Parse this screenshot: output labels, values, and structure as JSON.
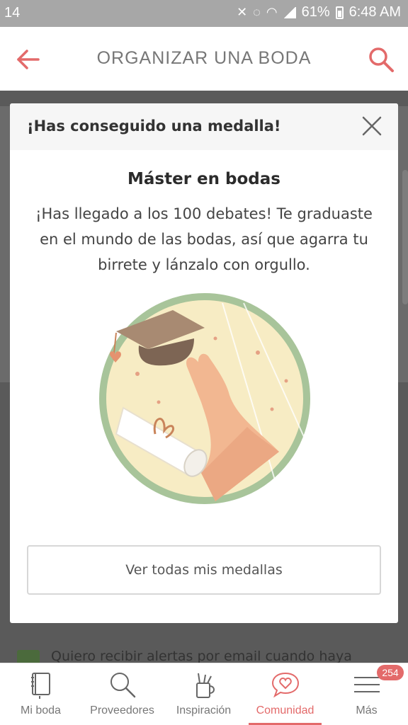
{
  "status_bar": {
    "left_text": "14",
    "battery": "61%",
    "time": "6:48 AM",
    "icons": [
      "mute-icon",
      "volte-icon",
      "wifi-icon",
      "signal-icon",
      "battery-icon"
    ]
  },
  "app_bar": {
    "title": "ORGANIZAR UNA BODA",
    "back_icon": "back-arrow-icon",
    "search_icon": "search-icon"
  },
  "background": {
    "checkbox_label": "Quiero recibir alertas por email cuando haya"
  },
  "modal": {
    "header_title": "¡Has conseguido una medalla!",
    "medal_title": "Máster en bodas",
    "medal_description": "¡Has llegado a los 100 debates! Te graduaste en el mundo de las bodas, así que agarra tu birrete y lánzalo con orgullo.",
    "button_label": "Ver todas mis medallas",
    "illustration": "graduation-medal-illustration"
  },
  "bottom_nav": {
    "items": [
      {
        "label": "Mi boda",
        "icon": "notebook-icon"
      },
      {
        "label": "Proveedores",
        "icon": "search-icon"
      },
      {
        "label": "Inspiración",
        "icon": "pencil-cup-icon"
      },
      {
        "label": "Comunidad",
        "icon": "chat-heart-icon",
        "active": true
      },
      {
        "label": "Más",
        "icon": "menu-icon",
        "badge": "254"
      }
    ]
  },
  "colors": {
    "accent": "#e36a6a",
    "illustration_ring": "#a8c49a",
    "illustration_bg": "#f7ecc4"
  }
}
